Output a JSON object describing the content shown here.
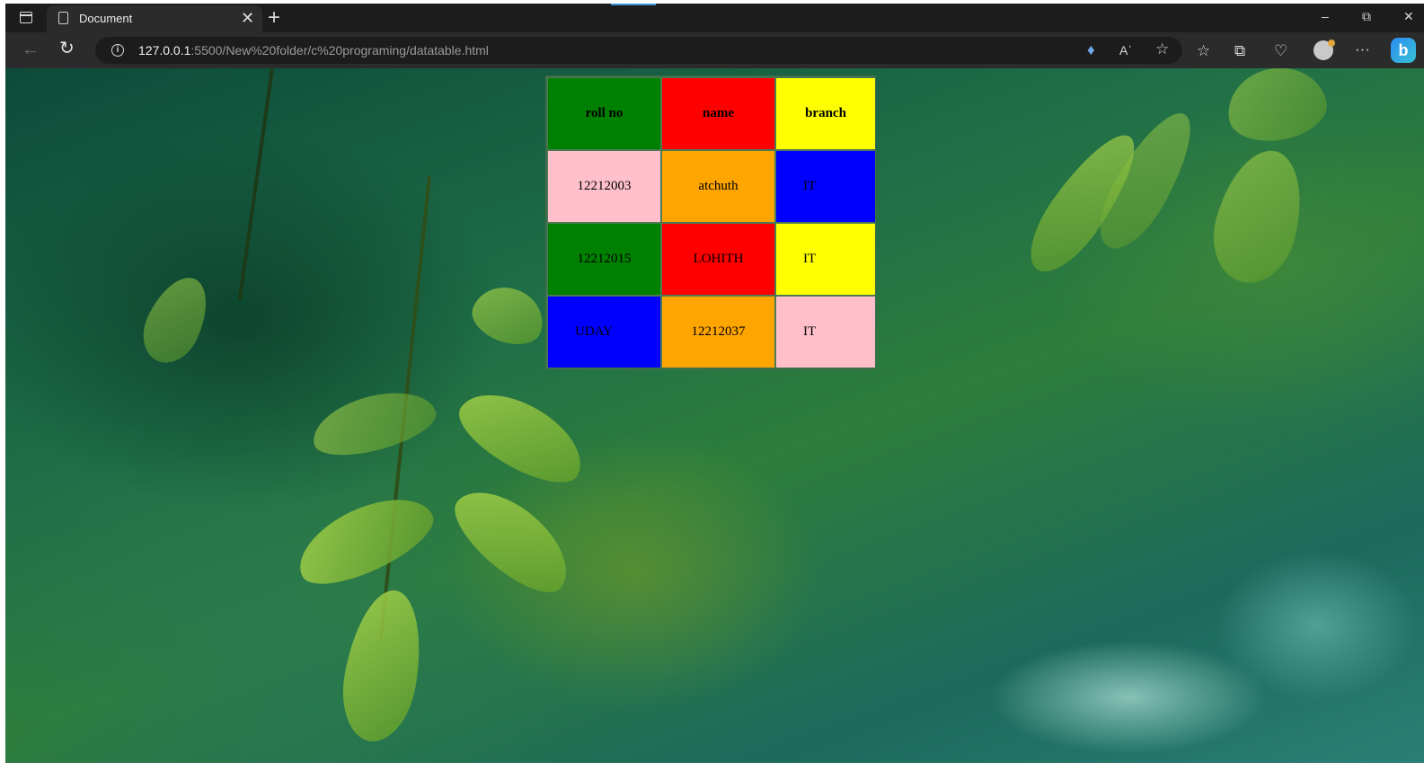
{
  "browser": {
    "tab_title": "Document",
    "tab_close": "✕",
    "new_tab": "+",
    "url_host": "127.0.0.1",
    "url_rest": ":5500/New%20folder/c%20programing/datatable.html",
    "more_menu": "···"
  },
  "table": {
    "headers": [
      "roll no",
      "name",
      "branch"
    ],
    "header_colors": [
      "#008000",
      "#ff0000",
      "#ffff00"
    ],
    "rows": [
      {
        "cells": [
          "12212003",
          "atchuth",
          "IT"
        ],
        "colors": [
          "#ffc0cb",
          "#ffa500",
          "#0000ff"
        ]
      },
      {
        "cells": [
          "12212015",
          "LOHITH",
          "IT"
        ],
        "colors": [
          "#008000",
          "#ff0000",
          "#ffff00"
        ]
      },
      {
        "cells": [
          "UDAY",
          "12212037",
          "IT"
        ],
        "colors": [
          "#0000ff",
          "#ffa500",
          "#ffc0cb"
        ]
      }
    ]
  },
  "icons": {
    "tab_actions": "tab-actions-icon",
    "page": "page-icon",
    "back": "back-arrow-icon",
    "refresh": "refresh-icon",
    "info": "info-icon",
    "coupon": "coupon-icon",
    "read_aloud": "read-aloud-icon",
    "add_favorite": "add-favorite-icon",
    "favorites": "favorites-icon",
    "collections": "collections-icon",
    "browser_essentials": "browser-essentials-icon",
    "profile": "avatar",
    "copilot": "copilot-icon"
  }
}
